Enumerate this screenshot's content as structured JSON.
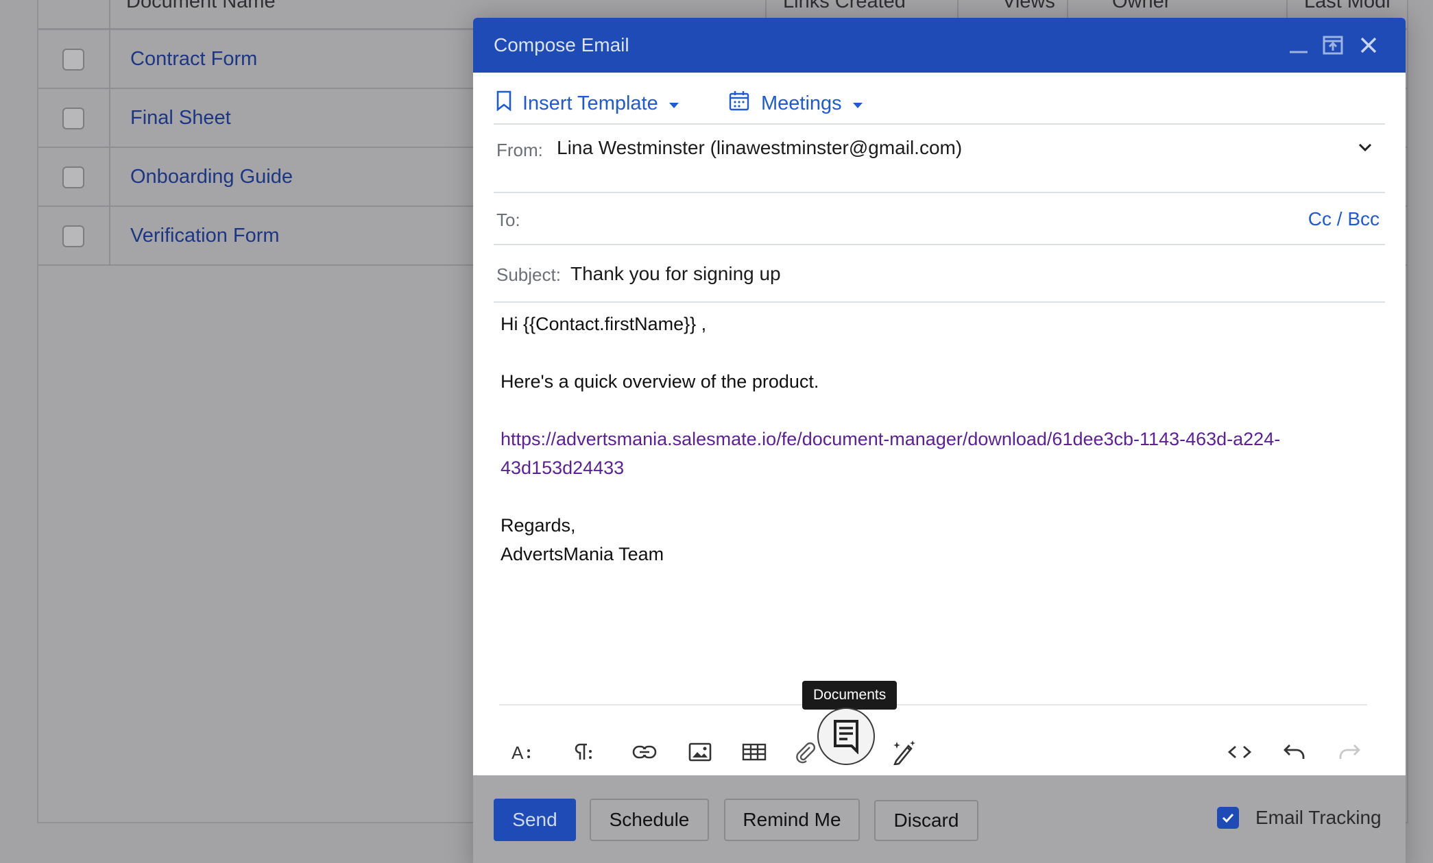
{
  "background_table": {
    "columns": [
      "Document Name",
      "Links Created",
      "Views",
      "Owner",
      "Last Modi"
    ],
    "rows": [
      {
        "name": "Contract Form"
      },
      {
        "name": "Final Sheet"
      },
      {
        "name": "Onboarding Guide"
      },
      {
        "name": "Verification Form"
      }
    ]
  },
  "compose": {
    "title": "Compose Email",
    "insert_template_label": "Insert Template",
    "meetings_label": "Meetings",
    "from_label": "From:",
    "from_value": "Lina Westminster (linawestminster@gmail.com)",
    "to_label": "To:",
    "to_value": "",
    "cc_bcc_label": "Cc / Bcc",
    "subject_label": "Subject:",
    "subject_value": "Thank you for signing up",
    "body": {
      "greeting": "Hi {{Contact.firstName}} ,",
      "intro": "Here's a quick overview of the product.",
      "link_line1": "https://advertsmania.salesmate.io/fe/document-manager/download/61dee3cb-1143-463d-a224-",
      "link_line2": "43d153d24433",
      "signoff": "Regards,",
      "signature": "AdvertsMania Team"
    },
    "tooltip": "Documents",
    "toolbar_icons": [
      "font-size-icon",
      "paragraph-icon",
      "link-icon",
      "image-icon",
      "table-icon",
      "attachment-icon",
      "documents-icon",
      "ai-writer-icon",
      "code-view-icon",
      "undo-icon",
      "redo-icon"
    ],
    "buttons": {
      "send": "Send",
      "schedule": "Schedule",
      "remind_me": "Remind Me",
      "discard": "Discard"
    },
    "email_tracking_label": "Email Tracking",
    "email_tracking_checked": true
  },
  "colors": {
    "accent": "#1e4bb5",
    "link": "#1f5ad6",
    "body_link": "#5b1f96"
  }
}
